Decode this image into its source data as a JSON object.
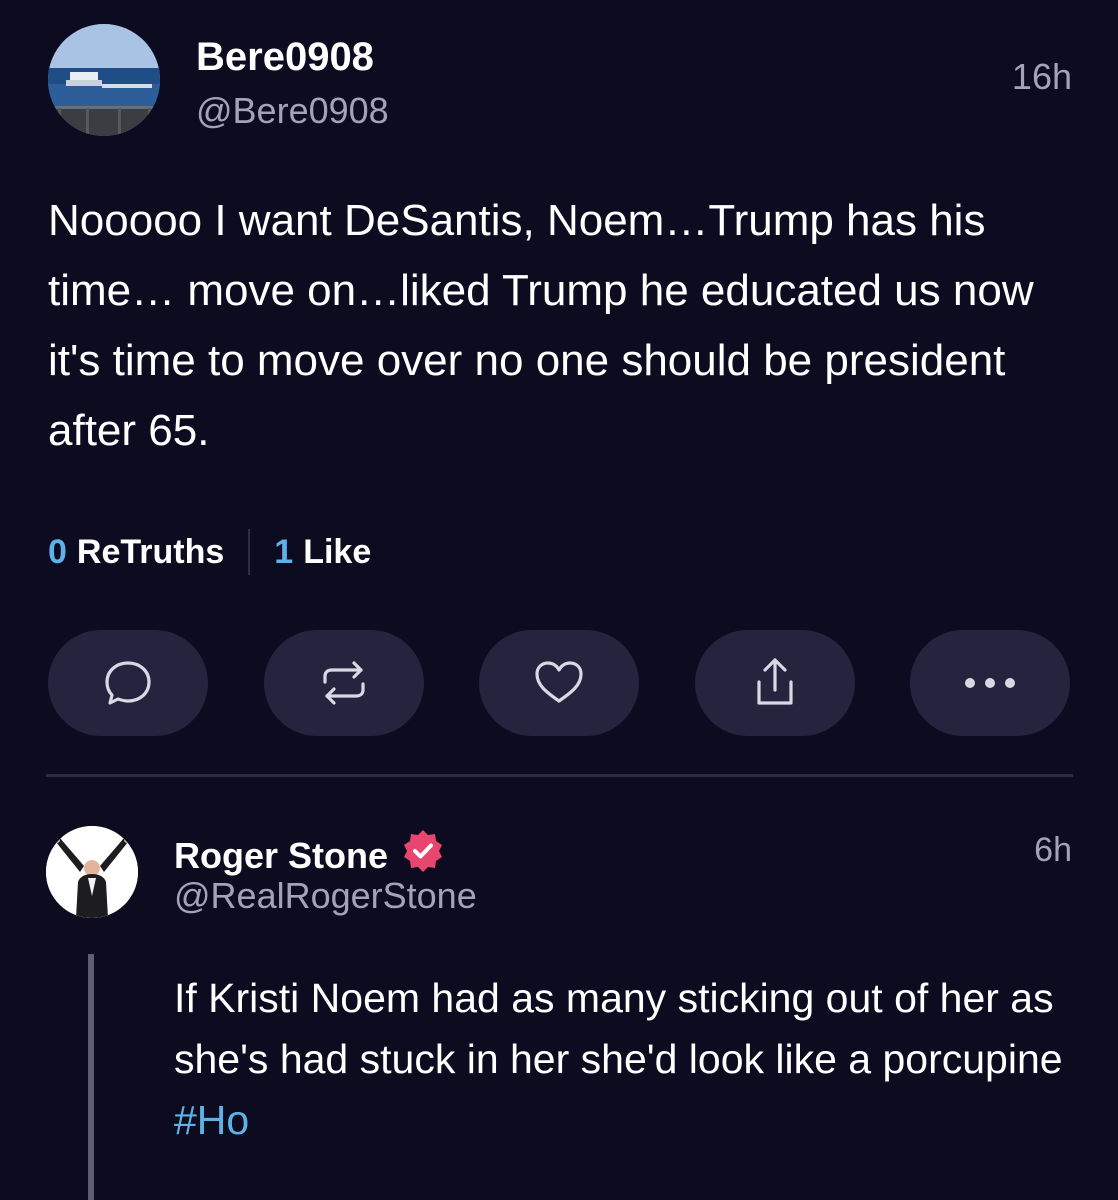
{
  "post": {
    "display_name": "Bere0908",
    "handle": "@Bere0908",
    "time": "16h",
    "body": "Nooooo I want DeSantis, Noem…Trump has his time… move on…liked Trump he educated us now it's time to move over no one should be president after 65.",
    "retruths_count": "0",
    "retruths_label": "ReTruths",
    "likes_count": "1",
    "likes_label": "Like"
  },
  "actions": [
    {
      "icon": "comment-icon"
    },
    {
      "icon": "retruth-icon"
    },
    {
      "icon": "heart-icon"
    },
    {
      "icon": "share-icon"
    },
    {
      "icon": "more-icon"
    }
  ],
  "reply": {
    "display_name": "Roger Stone",
    "verified_icon": "verified-badge-icon",
    "handle": "@RealRogerStone",
    "time": "6h",
    "body_text": "If Kristi Noem had as many sticking out of her as she's had stuck in her she'd look like a porcupine ",
    "hashtag": "#Ho"
  },
  "colors": {
    "background": "#0d0b1f",
    "accent": "#5fb2e8",
    "secondary_text": "#a3a2b8",
    "button_bg": "#25233d",
    "verified_badge": "#e8456f"
  }
}
